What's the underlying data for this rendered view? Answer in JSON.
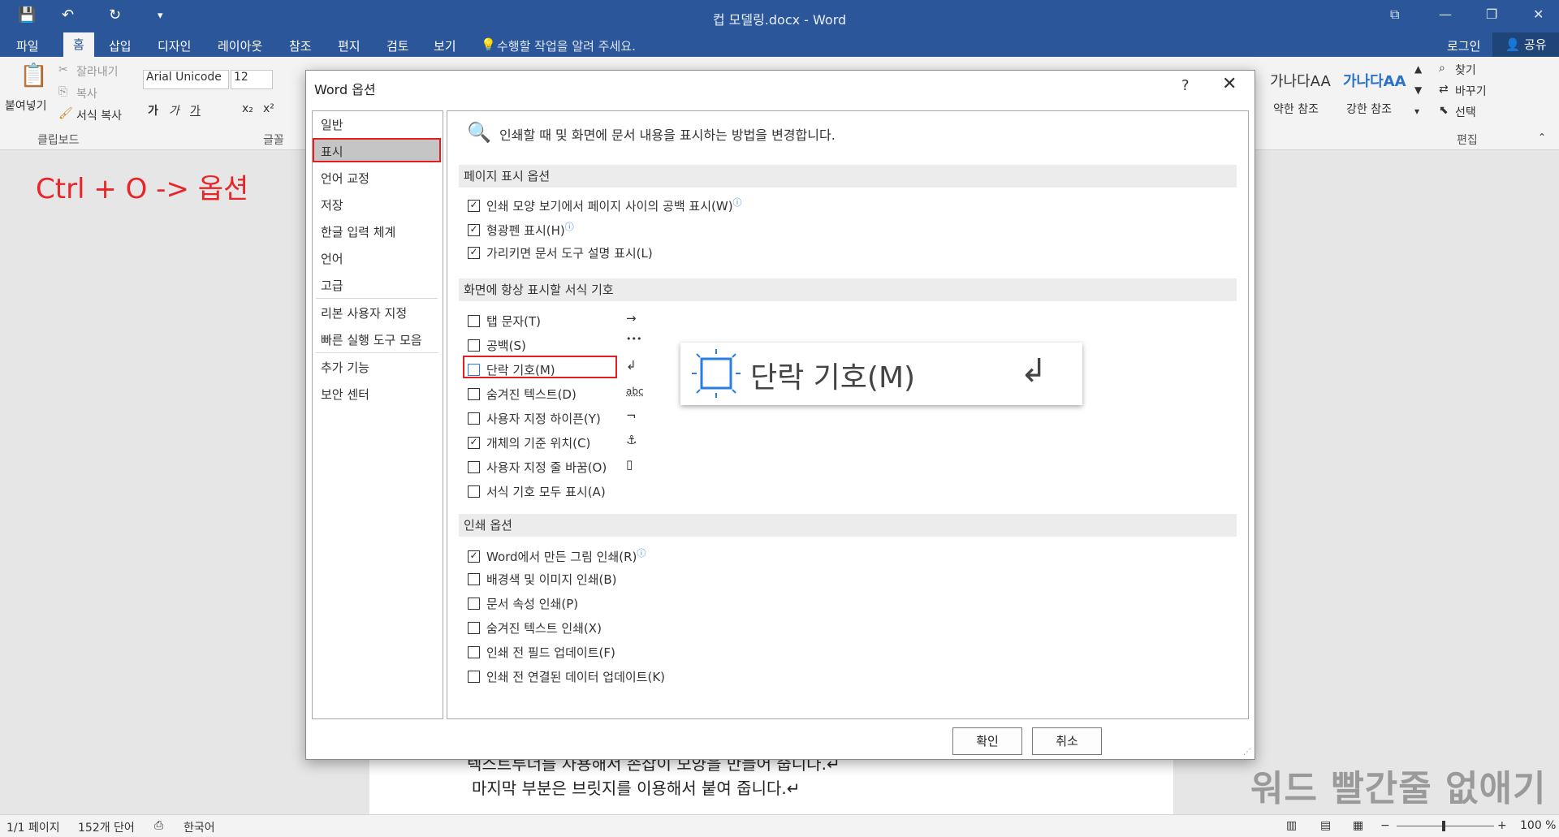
{
  "titlebar": {
    "title": "컵 모델링.docx - Word"
  },
  "tabs": {
    "items": [
      "파일",
      "홈",
      "삽입",
      "디자인",
      "레이아웃",
      "참조",
      "편지",
      "검토",
      "보기"
    ],
    "tellme": "수행할 작업을 알려 주세요.",
    "login": "로그인",
    "share": "공유"
  },
  "ribbon": {
    "paste": "붙여넣기",
    "cut": "잘라내기",
    "copy": "복사",
    "format_painter": "서식 복사",
    "clipboard_label": "클립보드",
    "font_name": "Arial Unicode",
    "font_size": "12",
    "font_label": "글꼴",
    "style1_sample": "가나다AA",
    "style1_label": "약한 참조",
    "style2_sample": "가나다AA",
    "style2_label": "강한 참조",
    "find": "찾기",
    "replace": "바꾸기",
    "select": "선택",
    "edit_label": "편집"
  },
  "overlay": {
    "shortcut": "Ctrl + O  ->  옵션",
    "watermark": "워드 빨간줄 없애기"
  },
  "document": {
    "line1": "텍스트루너를 사용해서 손잡이 모양을 만들어 줍니다.↵",
    "line2": "마지막 부분은 브릿지를 이용해서 붙여 줍니다.↵"
  },
  "status": {
    "page": "1/1 페이지",
    "words": "152개 단어",
    "lang": "한국어",
    "zoom": "100 %"
  },
  "dialog": {
    "title": "Word 옵션",
    "help": "?",
    "header": "인쇄할 때 및 화면에 문서 내용을 표시하는 방법을 변경합니다.",
    "nav": [
      "일반",
      "표시",
      "언어 교정",
      "저장",
      "한글 입력 체계",
      "언어",
      "고급",
      "리본 사용자 지정",
      "빠른 실행 도구 모음",
      "추가 기능",
      "보안 센터"
    ],
    "sections": {
      "page_display": "페이지 표시 옵션",
      "format_marks": "화면에 항상 표시할 서식 기호",
      "print": "인쇄 옵션"
    },
    "page_options": [
      {
        "label": "인쇄 모양 보기에서 페이지 사이의 공백 표시(W)",
        "checked": true
      },
      {
        "label": "형광펜 표시(H)",
        "checked": true
      },
      {
        "label": "가리키면 문서 도구 설명 표시(L)",
        "checked": true
      }
    ],
    "mark_options": [
      {
        "label": "탭 문자(T)",
        "symbol": "→",
        "checked": false
      },
      {
        "label": "공백(S)",
        "symbol": "•••",
        "checked": false
      },
      {
        "label": "단락 기호(M)",
        "symbol": "↲",
        "checked": false
      },
      {
        "label": "숨겨진 텍스트(D)",
        "symbol": "abc",
        "checked": false
      },
      {
        "label": "사용자 지정 하이픈(Y)",
        "symbol": "¬",
        "checked": false
      },
      {
        "label": "개체의 기준 위치(C)",
        "symbol": "⚓",
        "checked": true
      },
      {
        "label": "사용자 지정 줄 바꿈(O)",
        "symbol": "▯",
        "checked": false
      },
      {
        "label": "서식 기호 모두 표시(A)",
        "symbol": "",
        "checked": false
      }
    ],
    "print_options": [
      {
        "label": "Word에서 만든 그림 인쇄(R)",
        "checked": true
      },
      {
        "label": "배경색 및 이미지 인쇄(B)",
        "checked": false
      },
      {
        "label": "문서 속성 인쇄(P)",
        "checked": false
      },
      {
        "label": "숨겨진 텍스트 인쇄(X)",
        "checked": false
      },
      {
        "label": "인쇄 전 필드 업데이트(F)",
        "checked": false
      },
      {
        "label": "인쇄 전 연결된 데이터 업데이트(K)",
        "checked": false
      }
    ],
    "zoom_label": "단락 기호(M)",
    "ok": "확인",
    "cancel": "취소"
  },
  "colors": {
    "word_blue": "#2b579a",
    "highlight_red": "#e21d24"
  }
}
